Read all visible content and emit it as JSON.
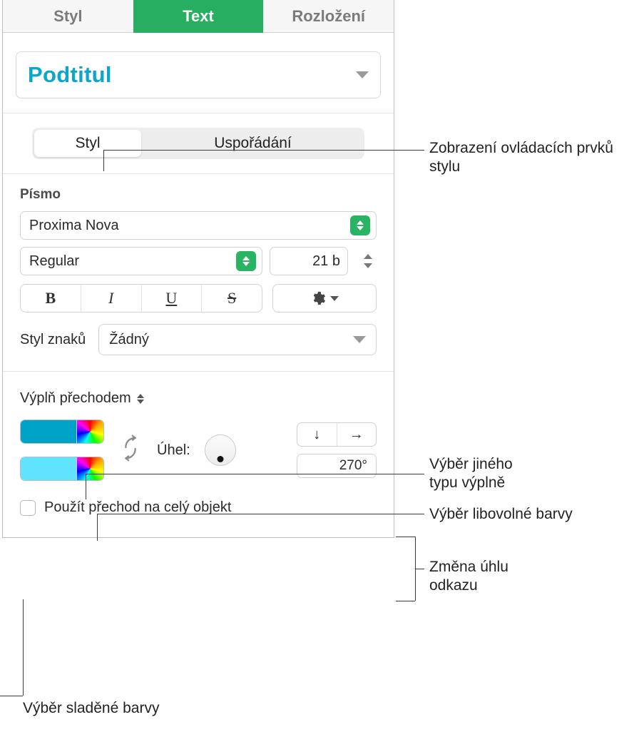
{
  "tabs": {
    "style": "Styl",
    "text": "Text",
    "layout": "Rozložení"
  },
  "paragraph_style": "Podtitul",
  "segmented": {
    "style": "Styl",
    "arrangement": "Uspořádání"
  },
  "font": {
    "section": "Písmo",
    "family": "Proxima Nova",
    "weight": "Regular",
    "size": "21 b",
    "char_style_label": "Styl znaků",
    "char_style_value": "Žádný",
    "buttons": {
      "bold": "B",
      "italic": "I",
      "underline": "U",
      "strike": "S"
    }
  },
  "fill": {
    "type_label": "Výplň přechodem",
    "angle_label": "Úhel:",
    "angle_value": "270°",
    "dir_down": "↓",
    "dir_right": "→",
    "apply_whole": "Použít přechod na celý objekt",
    "stops": {
      "color1": "#00a3c8",
      "color2": "#5fe3ff"
    }
  },
  "callouts": {
    "c1": "Zobrazení ovládacích prvků stylu",
    "c2a": "Výběr jiného",
    "c2b": "typu výplně",
    "c3": "Výběr libovolné barvy",
    "c4a": "Změna úhlu",
    "c4b": "odkazu",
    "c5": "Výběr sladěné barvy"
  }
}
